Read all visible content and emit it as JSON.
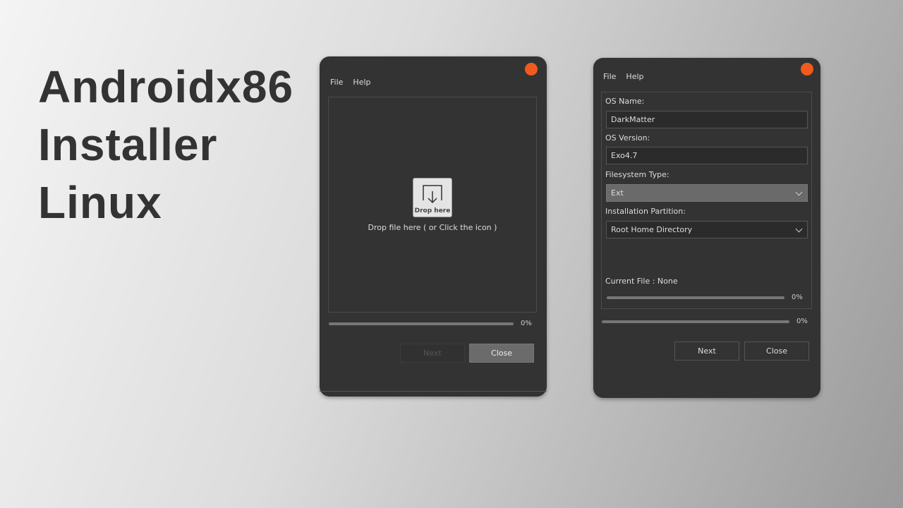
{
  "headline": [
    "Androidx86",
    "Installer",
    "Linux"
  ],
  "colors": {
    "close_dot": "#f05a1e",
    "window_bg": "#333333"
  },
  "window1": {
    "menu": [
      "File",
      "Help"
    ],
    "drop_icon_label": "Drop here",
    "drop_hint": "Drop file here ( or Click the icon )",
    "progress_percent": 0,
    "progress_label": "0%",
    "next_label": "Next",
    "close_label": "Close"
  },
  "window2": {
    "menu": [
      "File",
      "Help"
    ],
    "os_name_label": "OS Name:",
    "os_name_value": "DarkMatter",
    "os_version_label": "OS Version:",
    "os_version_value": "Exo4.7",
    "fs_type_label": "Filesystem Type:",
    "fs_type_value": "Ext",
    "partition_label": "Installation Partition:",
    "partition_value": "Root Home Directory",
    "current_file": "Current File : None",
    "file_progress_percent": 0,
    "file_progress_label": "0%",
    "total_progress_percent": 0,
    "total_progress_label": "0%",
    "next_label": "Next",
    "close_label": "Close"
  }
}
